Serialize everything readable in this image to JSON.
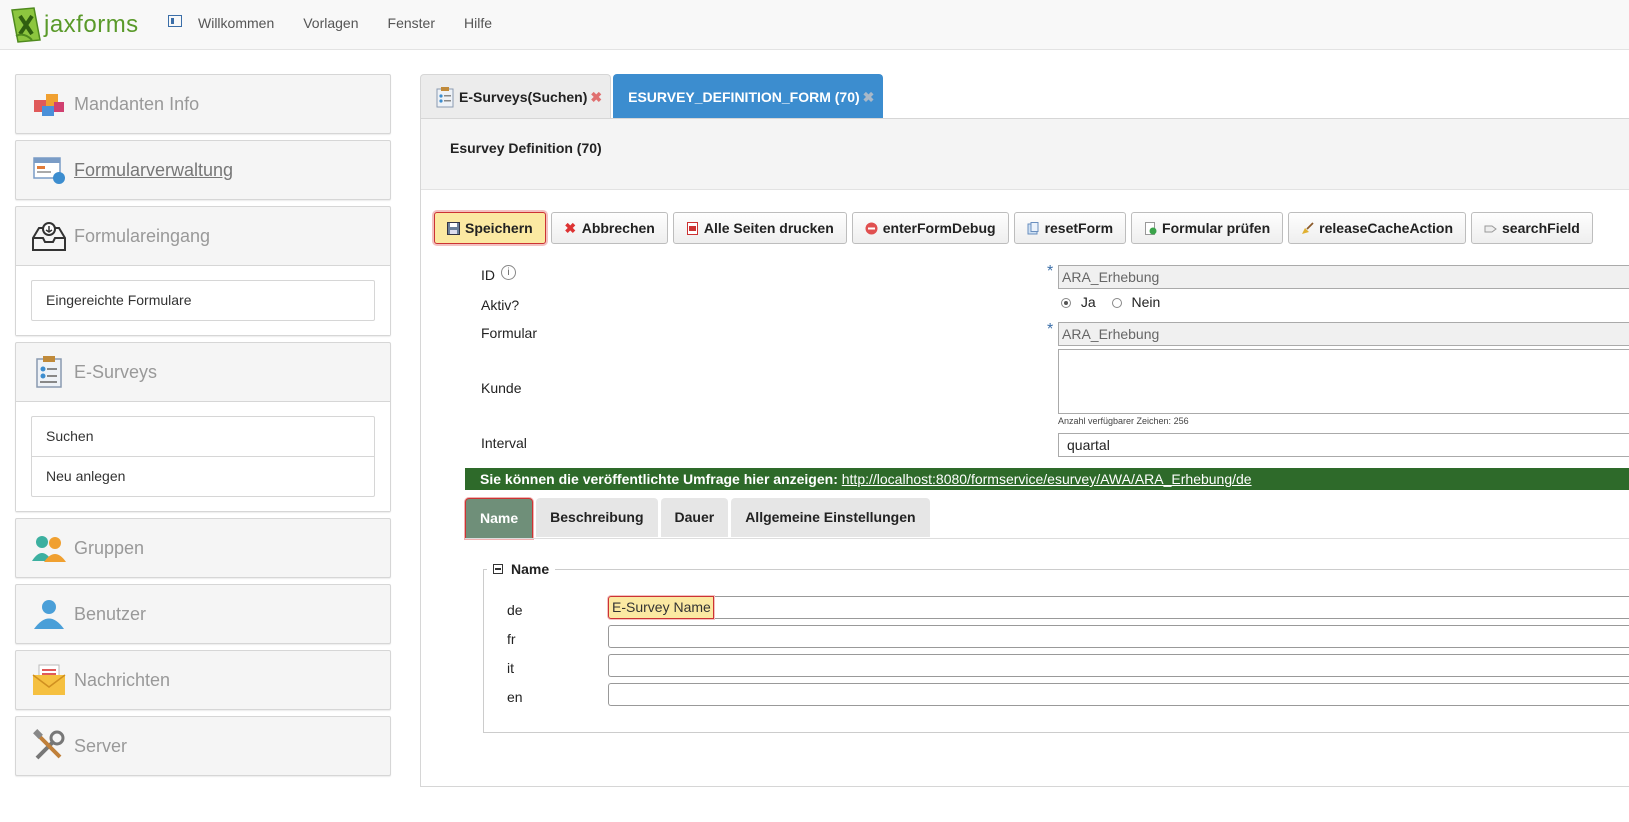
{
  "app": {
    "logo_text": "jaxforms"
  },
  "nav": {
    "items": [
      "Willkommen",
      "Vorlagen",
      "Fenster",
      "Hilfe"
    ]
  },
  "sidebar": {
    "mandanten": "Mandanten Info",
    "formularverwaltung": "Formularverwaltung",
    "formulareingang": "Formulareingang",
    "formulareingang_items": [
      "Eingereichte Formulare"
    ],
    "esurveys": "E-Surveys",
    "esurveys_items": [
      "Suchen",
      "Neu anlegen"
    ],
    "gruppen": "Gruppen",
    "benutzer": "Benutzer",
    "nachrichten": "Nachrichten",
    "server": "Server"
  },
  "tabs": [
    {
      "label": "E-Surveys(Suchen)",
      "close": "✖"
    },
    {
      "label": "ESURVEY_DEFINITION_FORM (70)",
      "close": "✖"
    }
  ],
  "form": {
    "title": "Esurvey Definition (70)",
    "toolbar": [
      "Speichern",
      "Abbrechen",
      "Alle Seiten drucken",
      "enterFormDebug",
      "resetForm",
      "Formular prüfen",
      "releaseCacheAction",
      "searchField"
    ],
    "fields": {
      "id_label": "ID",
      "id_value": "ARA_Erhebung",
      "aktiv_label": "Aktiv?",
      "aktiv_ja": "Ja",
      "aktiv_nein": "Nein",
      "aktiv_selected": "Ja",
      "formular_label": "Formular",
      "formular_value": "ARA_Erhebung",
      "kunde_label": "Kunde",
      "kunde_hint": "Anzahl verfügbarer Zeichen: 256",
      "interval_label": "Interval",
      "interval_value": "quartal"
    },
    "banner_text": "Sie können die veröffentlichte Umfrage hier anzeigen:",
    "banner_link": "http://localhost:8080/formservice/esurvey/AWA/ARA_Erhebung/de",
    "subtabs": [
      "Name",
      "Beschreibung",
      "Dauer",
      "Allgemeine Einstellungen"
    ],
    "name_section": {
      "legend": "Name",
      "langs": [
        {
          "label": "de",
          "value": "E-Survey Name"
        },
        {
          "label": "fr",
          "value": ""
        },
        {
          "label": "it",
          "value": ""
        },
        {
          "label": "en",
          "value": ""
        }
      ]
    }
  },
  "colors": {
    "accent": "#3c8dcf",
    "banner": "#2e6a2a",
    "highlight": "#fbe9a2",
    "active_subtab": "#6f8f79"
  }
}
